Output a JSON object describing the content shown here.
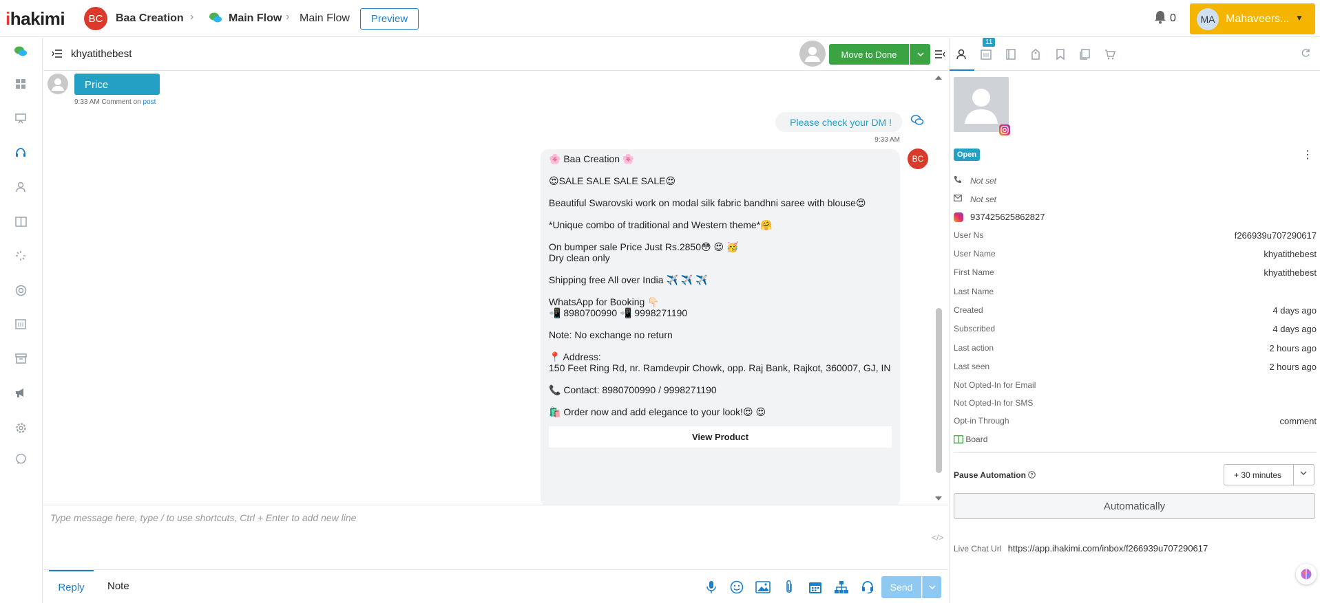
{
  "topbar": {
    "logo_i": "i",
    "logo_rest": "hakimi",
    "account_initials": "BC",
    "account_name": "Baa Creation",
    "flow_name": "Main Flow",
    "flow_step": "Main Flow",
    "preview_label": "Preview",
    "notification_count": "0",
    "user_initials": "MA",
    "user_name": "Mahaveers..."
  },
  "sidebar": {
    "items": [
      "chat-bubbles-icon",
      "dashboard-icon",
      "presentation-icon",
      "headset-icon",
      "user-icon",
      "board-icon",
      "loader-icon",
      "lifebuoy-icon",
      "calendar-icon",
      "archive-icon",
      "megaphone-icon",
      "settings-icon",
      "comment-icon"
    ]
  },
  "chat": {
    "title": "khyatithebest",
    "move_to_done_label": "Move to Done",
    "incoming": {
      "text": "Price",
      "time": "9:33 AM",
      "meta_prefix": "Comment on",
      "meta_link": "post"
    },
    "outgoing_dm": {
      "text": "Please check your DM !",
      "time": "9:33 AM"
    },
    "outgoing_card": {
      "sender_initials": "BC",
      "lines": [
        "🌸 Baa Creation 🌸",
        "😍SALE SALE SALE SALE😍",
        "Beautiful Swarovski work on modal silk fabric bandhni saree with blouse😍",
        "*Unique combo of traditional and Western theme*🤗",
        "On bumper sale Price Just Rs.2850😳 😍 🥳",
        "Dry clean only",
        "Shipping free All over India ✈️ ✈️ ✈️",
        "WhatsApp for Booking 👇🏻",
        "📲 8980700990  📲 9998271190",
        "Note: No exchange no return",
        "📍 Address:",
        "150 Feet Ring Rd, nr. Ramdevpir Chowk, opp. Raj Bank, Rajkot, 360007, GJ, IN",
        "📞 Contact: 8980700990 / 9998271190",
        "🛍️ Order now and add elegance to your look!😍 😍"
      ],
      "button_label": "View Product"
    }
  },
  "composer": {
    "placeholder": "Type message here, type / to use shortcuts, Ctrl + Enter to add new line",
    "code_icon": "</>",
    "tab_reply": "Reply",
    "tab_note": "Note",
    "send_label": "Send",
    "tools": [
      "microphone-icon",
      "emoji-icon",
      "image-icon",
      "attachment-icon",
      "calendar-icon",
      "flow-icon",
      "headset-icon"
    ]
  },
  "panel": {
    "tab_badge": "11",
    "status": "Open",
    "phone": "Not set",
    "email": "Not set",
    "instagram_id": "937425625862827",
    "fields": [
      {
        "key": "User Ns",
        "value": "f266939u707290617"
      },
      {
        "key": "User Name",
        "value": "khyatithebest"
      },
      {
        "key": "First Name",
        "value": "khyatithebest"
      },
      {
        "key": "Last Name",
        "value": ""
      },
      {
        "key": "Created",
        "value": "4 days ago"
      },
      {
        "key": "Subscribed",
        "value": "4 days ago"
      },
      {
        "key": "Last action",
        "value": "2 hours ago"
      },
      {
        "key": "Last seen",
        "value": "2 hours ago"
      },
      {
        "key": "Not Opted-In for Email",
        "value": ""
      },
      {
        "key": "Not Opted-In for SMS",
        "value": ""
      },
      {
        "key": "Opt-in Through",
        "value": "comment"
      }
    ],
    "board_label": "Board",
    "pause_label": "Pause Automation",
    "pause_value": "+ 30 minutes",
    "automatically_label": "Automatically",
    "live_chat_label": "Live Chat Url",
    "live_chat_url": "https://app.ihakimi.com/inbox/f266939u707290617"
  },
  "colors": {
    "brand_red": "#d93a2b",
    "accent_blue": "#1e7fc9",
    "teal": "#23a0c4",
    "green": "#3aa445",
    "yellow": "#f5b400"
  }
}
